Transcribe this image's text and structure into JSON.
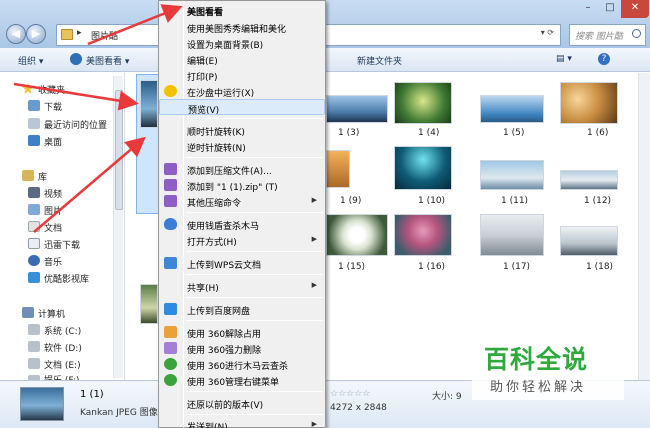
{
  "window": {
    "address_crumb": "图片酷",
    "search_placeholder": "搜索 图片酷",
    "controls": [
      "–",
      "□",
      "✕"
    ]
  },
  "toolbar": {
    "organize": "组织 ▾",
    "viewer": "美图看看 ▾",
    "new_folder": "新建文件夹",
    "view_icon": "▤ ▾",
    "help": "?"
  },
  "sidebar": {
    "favorites": "收藏夹",
    "downloads": "下载",
    "recent": "最近访问的位置",
    "desktop": "桌面",
    "library": "库",
    "videos": "视频",
    "pictures": "图片",
    "documents": "文档",
    "xunlei": "迅雷下载",
    "music": "音乐",
    "youku": "优酷影视库",
    "computer": "计算机",
    "drive_c": "系统 (C:)",
    "drive_d": "软件 (D:)",
    "drive_e": "文档 (E:)",
    "drive_f": "娱乐 (F:)"
  },
  "files": [
    {
      "label": "1 (3)"
    },
    {
      "label": "1 (4)"
    },
    {
      "label": "1 (5)"
    },
    {
      "label": "1 (6)"
    },
    {
      "label": "1 (9)"
    },
    {
      "label": "1 (10)"
    },
    {
      "label": "1 (11)"
    },
    {
      "label": "1 (12)"
    },
    {
      "label": "1 (15)"
    },
    {
      "label": "1 (16)"
    },
    {
      "label": "1 (17)"
    },
    {
      "label": "1 (18)"
    }
  ],
  "menu": {
    "items": [
      {
        "label": "美图看看"
      },
      {
        "label": "使用美图秀秀编辑和美化"
      },
      {
        "label": "设置为桌面背景(B)"
      },
      {
        "label": "编辑(E)"
      },
      {
        "label": "打印(P)"
      },
      {
        "label": "在沙盘中运行(X)"
      },
      {
        "label": "预览(V)"
      },
      {
        "label": "顺时针旋转(K)"
      },
      {
        "label": "逆时针旋转(N)"
      },
      {
        "label": "添加到压缩文件(A)..."
      },
      {
        "label": "添加到 \"1 (1).zip\" (T)"
      },
      {
        "label": "其他压缩命令"
      },
      {
        "label": "使用钱盾查杀木马"
      },
      {
        "label": "打开方式(H)"
      },
      {
        "label": "上传到WPS云文档"
      },
      {
        "label": "共享(H)"
      },
      {
        "label": "上传到百度网盘"
      },
      {
        "label": "使用 360解除占用"
      },
      {
        "label": "使用 360强力删除"
      },
      {
        "label": "使用 360进行木马云查杀"
      },
      {
        "label": "使用 360管理右键菜单"
      },
      {
        "label": "还原以前的版本(V)"
      },
      {
        "label": "发送到(N)"
      }
    ]
  },
  "details": {
    "name": "1 (1)",
    "type": "Kankan JPEG 图像",
    "dimensions": "4272 x 2848",
    "size_label": "大小: 9",
    "rating": "☆☆☆☆☆"
  },
  "watermark": {
    "title": "百科全说",
    "subtitle": "助你轻松解决"
  },
  "colors": {
    "annotation_arrow": "#e83a3a",
    "menu_highlight": "#dcebf9",
    "watermark_green": "#2eaa3d"
  }
}
